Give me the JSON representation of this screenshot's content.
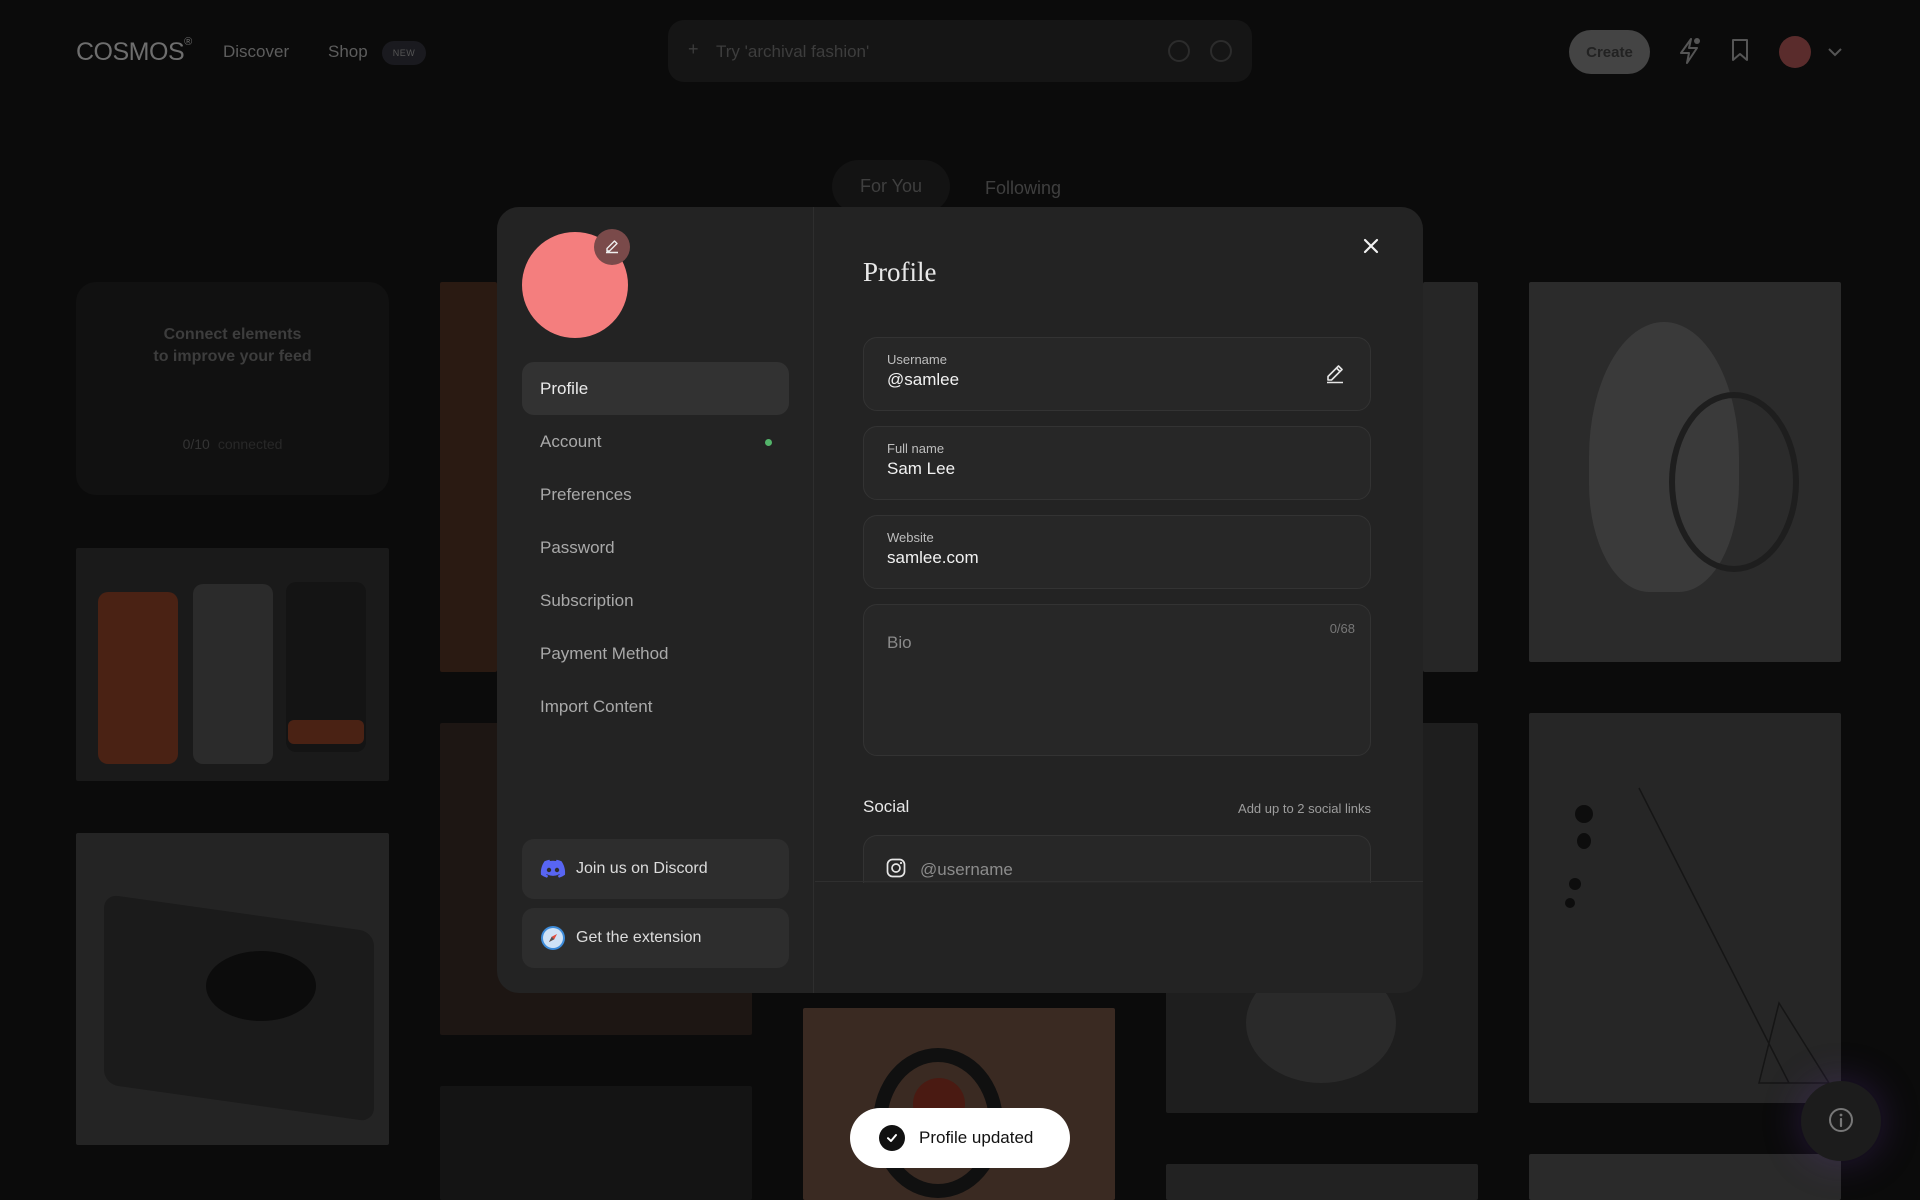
{
  "header": {
    "logo": "COSMOS",
    "logo_mark": "®",
    "nav": [
      {
        "label": "Discover"
      },
      {
        "label": "Shop"
      }
    ],
    "shop_badge": "NEW",
    "search_placeholder": "Try 'archival fashion'",
    "create_label": "Create"
  },
  "feed": {
    "tabs": [
      {
        "label": "For You"
      },
      {
        "label": "Following"
      }
    ],
    "connect_card": {
      "line1": "Connect elements",
      "line2": "to improve your feed",
      "count": "0/10",
      "count_suffix": "connected"
    }
  },
  "modal": {
    "title": "Profile",
    "side_nav": [
      {
        "label": "Profile",
        "active": true
      },
      {
        "label": "Account",
        "dot": true
      },
      {
        "label": "Preferences"
      },
      {
        "label": "Password"
      },
      {
        "label": "Subscription"
      },
      {
        "label": "Payment Method"
      },
      {
        "label": "Import Content"
      }
    ],
    "discord_label": "Join us on Discord",
    "extension_label": "Get the extension",
    "fields": {
      "username": {
        "label": "Username",
        "value": "@samlee"
      },
      "fullname": {
        "label": "Full name",
        "value": "Sam Lee"
      },
      "website": {
        "label": "Website",
        "value": "samlee.com"
      },
      "bio": {
        "placeholder": "Bio",
        "counter": "0/68"
      }
    },
    "social": {
      "label": "Social",
      "hint": "Add up to 2 social links",
      "placeholder": "@username"
    }
  },
  "toast": {
    "message": "Profile updated"
  },
  "colors": {
    "avatar": "#f47e7e",
    "modal_bg": "#232323",
    "online_dot": "#53b46a",
    "discord": "#5865f2"
  },
  "icons": [
    "pencil-icon",
    "close-icon",
    "discord-icon",
    "compass-icon",
    "instagram-icon",
    "check-icon",
    "info-icon",
    "bolt-icon",
    "bookmark-icon",
    "chevron-down-icon"
  ]
}
